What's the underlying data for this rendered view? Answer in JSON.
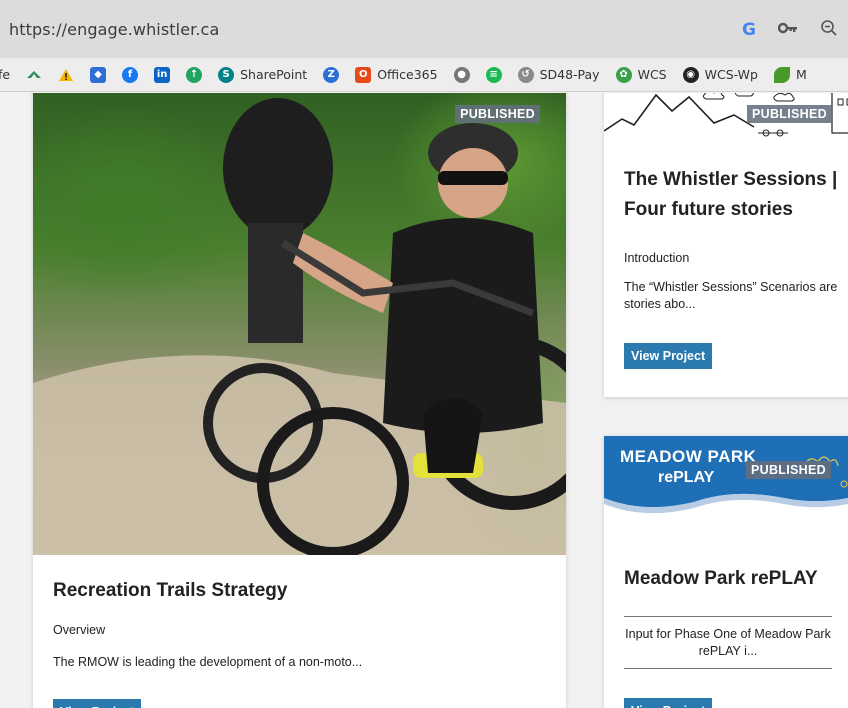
{
  "browser": {
    "url": "https://engage.whistler.ca",
    "bookmarks": [
      {
        "label": "fe",
        "icon": ""
      },
      {
        "label": "",
        "icon": "arrow-icon"
      },
      {
        "label": "",
        "icon": "warning-icon"
      },
      {
        "label": "",
        "icon": "dropbox-icon"
      },
      {
        "label": "",
        "icon": "facebook-icon"
      },
      {
        "label": "",
        "icon": "linkedin-icon"
      },
      {
        "label": "",
        "icon": "cloud-icon"
      },
      {
        "label": "SharePoint",
        "icon": "sharepoint-icon"
      },
      {
        "label": "",
        "icon": "zoom-icon"
      },
      {
        "label": "Office365",
        "icon": "office-icon"
      },
      {
        "label": "",
        "icon": "apple-icon"
      },
      {
        "label": "",
        "icon": "spotify-icon"
      },
      {
        "label": "SD48-Pay",
        "icon": "pay-icon"
      },
      {
        "label": "WCS",
        "icon": "wcs-icon"
      },
      {
        "label": "WCS-Wp",
        "icon": "github-icon"
      },
      {
        "label": "M",
        "icon": "leaf-icon"
      }
    ]
  },
  "cards": {
    "main": {
      "badge": "PUBLISHED",
      "title": "Recreation Trails Strategy",
      "label": "Overview",
      "description": "The RMOW is leading the development of a non-moto...",
      "button": "View Project"
    },
    "sessions": {
      "badge": "PUBLISHED",
      "title": "The Whistler Sessions | Four future stories",
      "label": "Introduction",
      "description": "The “Whistler Sessions” Scenarios are stories abo...",
      "button": "View Project"
    },
    "meadow": {
      "banner_line1": "MEADOW PARK",
      "banner_line2": "rePLAY",
      "badge": "PUBLISHED",
      "title": "Meadow Park rePLAY",
      "description": "Input for Phase One of Meadow Park rePLAY i...",
      "button": "View Project"
    }
  },
  "colors": {
    "button": "#2a7ab0",
    "badge": "#646e7d",
    "banner": "#1e6fb6"
  }
}
